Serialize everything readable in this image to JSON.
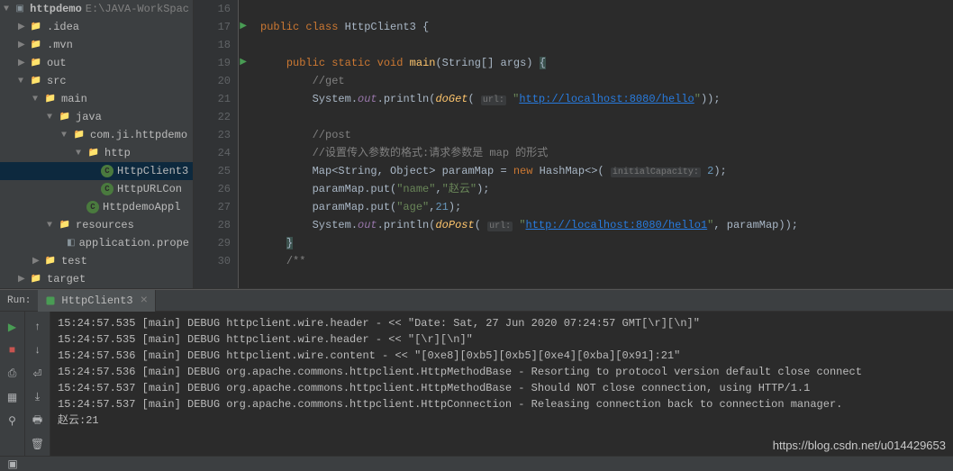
{
  "project": {
    "root": {
      "name": "httpdemo",
      "path": "E:\\JAVA-WorkSpac"
    },
    "tree": [
      {
        "indent": 1,
        "arrow": "▶",
        "icon": "folder",
        "label": ".idea"
      },
      {
        "indent": 1,
        "arrow": "▶",
        "icon": "folder",
        "label": ".mvn"
      },
      {
        "indent": 1,
        "arrow": "▶",
        "icon": "folder-orange",
        "label": "out"
      },
      {
        "indent": 1,
        "arrow": "▼",
        "icon": "folder",
        "label": "src"
      },
      {
        "indent": 2,
        "arrow": "▼",
        "icon": "folder",
        "label": "main"
      },
      {
        "indent": 3,
        "arrow": "▼",
        "icon": "folder-blue",
        "label": "java"
      },
      {
        "indent": 4,
        "arrow": "▼",
        "icon": "folder",
        "label": "com.ji.httpdemo"
      },
      {
        "indent": 5,
        "arrow": "▼",
        "icon": "folder",
        "label": "http"
      },
      {
        "indent": 6,
        "arrow": "",
        "icon": "class",
        "label": "HttpClient3",
        "selected": true
      },
      {
        "indent": 6,
        "arrow": "",
        "icon": "class",
        "label": "HttpURLCon"
      },
      {
        "indent": 5,
        "arrow": "",
        "icon": "class",
        "label": "HttpdemoAppl"
      },
      {
        "indent": 3,
        "arrow": "▼",
        "icon": "folder",
        "label": "resources"
      },
      {
        "indent": 4,
        "arrow": "",
        "icon": "file",
        "label": "application.prope"
      },
      {
        "indent": 2,
        "arrow": "▶",
        "icon": "folder",
        "label": "test"
      },
      {
        "indent": 1,
        "arrow": "▶",
        "icon": "folder-orange",
        "label": "target"
      }
    ]
  },
  "editor": {
    "lines": [
      16,
      17,
      18,
      19,
      20,
      21,
      22,
      23,
      24,
      25,
      26,
      27,
      28,
      29,
      30
    ],
    "runMarkers": [
      17,
      19
    ],
    "code": {
      "class_kw": "public class",
      "class_name": "HttpClient3",
      "method_sig": {
        "public": "public",
        "static": "static",
        "void": "void",
        "main": "main",
        "params": "(String[] args)"
      },
      "comment_get": "//get",
      "sys": "System",
      "out": "out",
      "println": "println",
      "doGet": "doGet",
      "hint_url": "url:",
      "url1": "\"http://localhost:8080/hello\"",
      "comment_post": "//post",
      "comment_chinese": "//设置传入参数的格式:请求参数是 map 的形式",
      "map_decl": {
        "type": "Map<String, Object>",
        "var": "paramMap",
        "new": "new",
        "hashmap": "HashMap<>",
        "hint": "initialCapacity:",
        "val": "2"
      },
      "put1": {
        "key": "\"name\"",
        "val": "\"赵云\""
      },
      "put2": {
        "key": "\"age\"",
        "val": "21"
      },
      "doPost": "doPost",
      "url2": "\"http://localhost:8080/hello1\"",
      "param_var": "paramMap",
      "doc_comment": "/**"
    }
  },
  "run": {
    "label": "Run:",
    "tab": "HttpClient3",
    "output": [
      "15:24:57.535 [main] DEBUG httpclient.wire.header - << \"Date: Sat, 27 Jun 2020 07:24:57 GMT[\\r][\\n]\"",
      "15:24:57.535 [main] DEBUG httpclient.wire.header - << \"[\\r][\\n]\"",
      "15:24:57.536 [main] DEBUG httpclient.wire.content - << \"[0xe8][0xb5][0xb5][0xe4][0xba][0x91]:21\"",
      "15:24:57.536 [main] DEBUG org.apache.commons.httpclient.HttpMethodBase - Resorting to protocol version default close connect",
      "15:24:57.537 [main] DEBUG org.apache.commons.httpclient.HttpMethodBase - Should NOT close connection, using HTTP/1.1",
      "15:24:57.537 [main] DEBUG org.apache.commons.httpclient.HttpConnection - Releasing connection back to connection manager.",
      "赵云:21"
    ]
  },
  "watermark": "https://blog.csdn.net/u014429653"
}
